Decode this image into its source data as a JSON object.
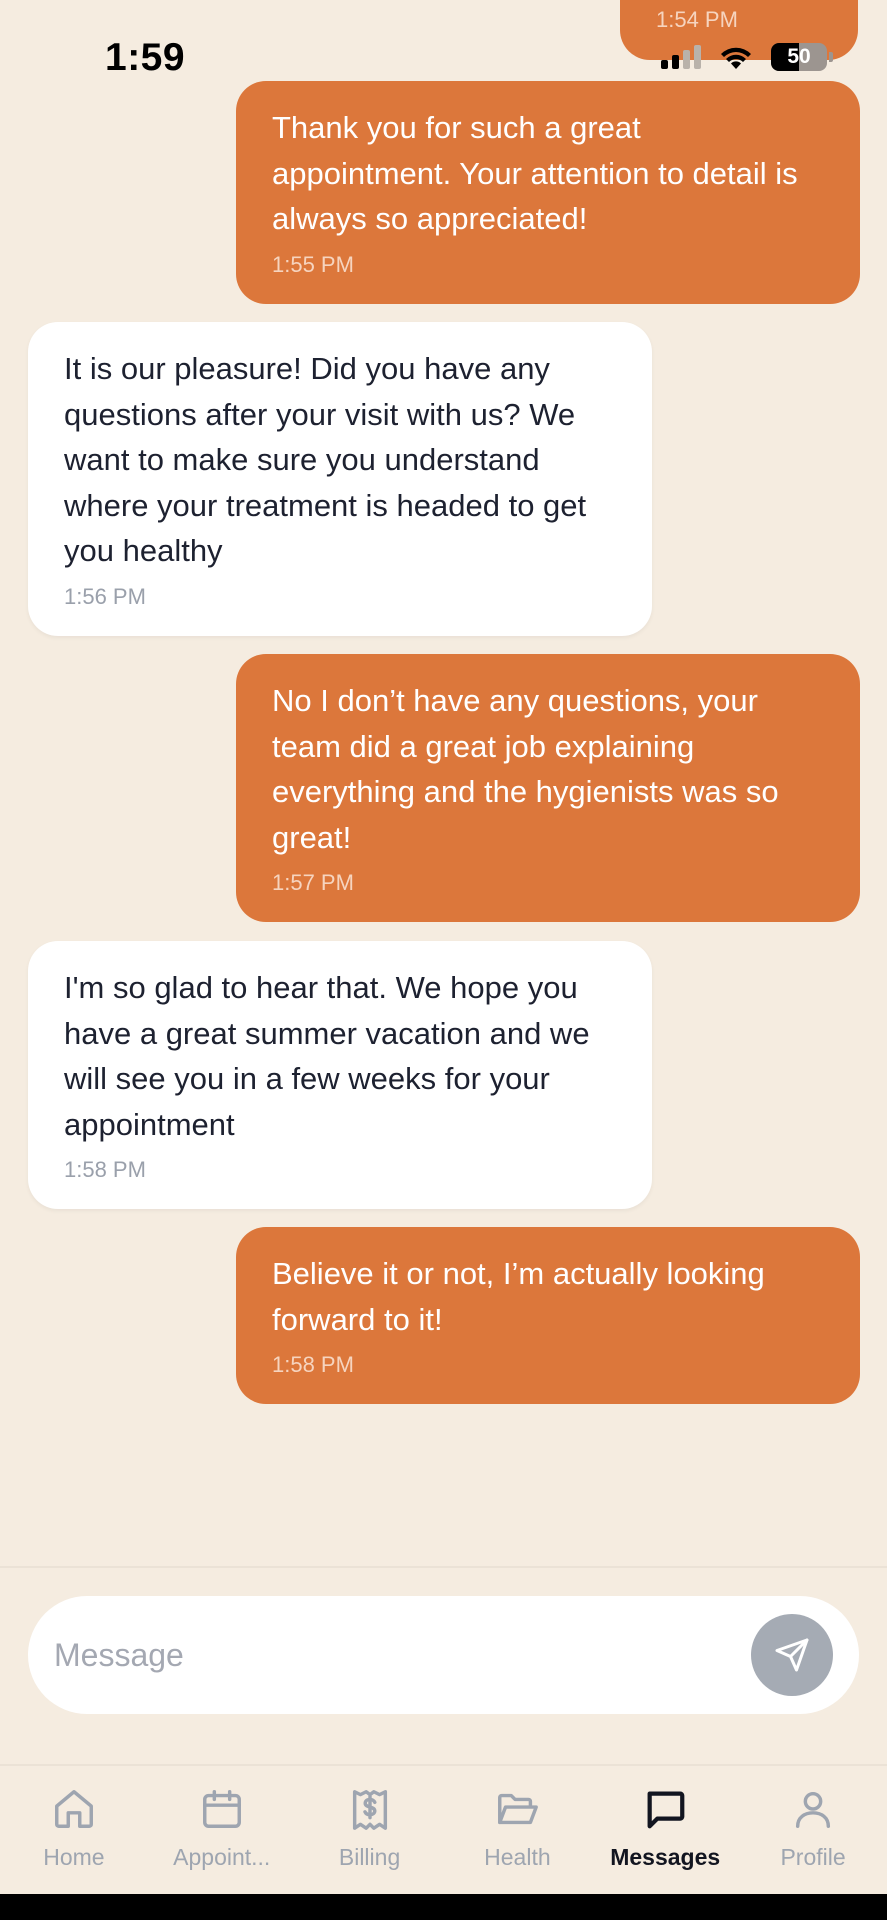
{
  "status_bar": {
    "time": "1:59",
    "battery": "50"
  },
  "messages": {
    "top_partial": {
      "time": "1:54 PM"
    },
    "list": [
      {
        "direction": "out",
        "text": "Thank you for such a great appointment. Your attention to detail is always so appreciated!",
        "time": "1:55 PM"
      },
      {
        "direction": "in",
        "text": "It is our pleasure! Did you have any questions after your visit with us? We want to make sure you understand where your treatment is headed to get you healthy",
        "time": "1:56 PM"
      },
      {
        "direction": "out",
        "text": "No I don’t have any questions, your team did a great job explaining everything and the hygienists was so great!",
        "time": "1:57 PM"
      },
      {
        "direction": "in",
        "text": "I'm so glad to hear that. We hope you have a great summer vacation and we will see you in a few weeks for your appointment",
        "time": "1:58 PM"
      },
      {
        "direction": "out",
        "text": "Believe it or not, I’m actually looking forward to it!",
        "time": "1:58 PM"
      }
    ]
  },
  "composer": {
    "placeholder": "Message",
    "value": ""
  },
  "tabs": [
    {
      "label": "Home",
      "icon": "home-icon",
      "active": false
    },
    {
      "label": "Appoint...",
      "icon": "calendar-icon",
      "active": false
    },
    {
      "label": "Billing",
      "icon": "receipt-dollar-icon",
      "active": false
    },
    {
      "label": "Health",
      "icon": "folder-open-icon",
      "active": false
    },
    {
      "label": "Messages",
      "icon": "chat-bubble-icon",
      "active": true
    },
    {
      "label": "Profile",
      "icon": "user-icon",
      "active": false
    }
  ],
  "colors": {
    "background": "#f5ece0",
    "outgoing_bubble": "#dc773b",
    "incoming_bubble": "#ffffff",
    "inactive_tab": "#9ea5b0",
    "active_tab": "#121520",
    "send_button": "#a5abb4"
  }
}
